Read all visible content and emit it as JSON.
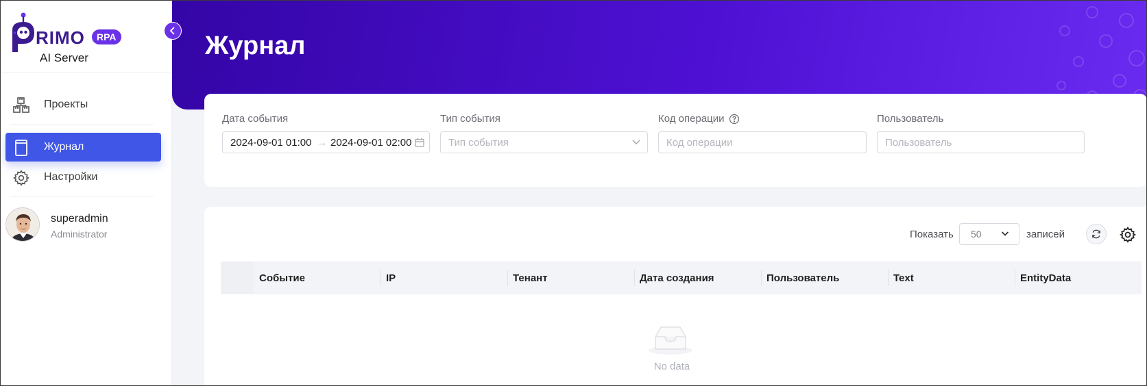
{
  "brand": {
    "wordmark": "RIMO",
    "badge": "RPA",
    "subtitle": "AI Server",
    "accent": "#6a31e8"
  },
  "sidebar": {
    "items": [
      {
        "label": "Проекты",
        "icon": "projects-icon",
        "active": false
      },
      {
        "label": "Журнал",
        "icon": "journal-icon",
        "active": true
      },
      {
        "label": "Настройки",
        "icon": "gear-icon",
        "active": false
      }
    ],
    "active_color": "#3f56e6"
  },
  "user": {
    "name": "superadmin",
    "role": "Administrator"
  },
  "header": {
    "title": "Журнал",
    "gradient_from": "#3405a6",
    "gradient_to": "#6a2bf0"
  },
  "filters": {
    "date": {
      "label": "Дата события",
      "start": "2024-09-01 01:00",
      "separator": "→",
      "end": "2024-09-01 02:00"
    },
    "event_type": {
      "label": "Тип события",
      "placeholder": "Тип события"
    },
    "operation_code": {
      "label": "Код операции",
      "placeholder": "Код операции"
    },
    "user": {
      "label": "Пользователь",
      "placeholder": "Пользователь"
    }
  },
  "table": {
    "show_label": "Показать",
    "page_size": "50",
    "records_label": "записей",
    "columns": [
      "Событие",
      "IP",
      "Тенант",
      "Дата создания",
      "Пользователь",
      "Text",
      "EntityData"
    ],
    "empty_text": "No data"
  }
}
